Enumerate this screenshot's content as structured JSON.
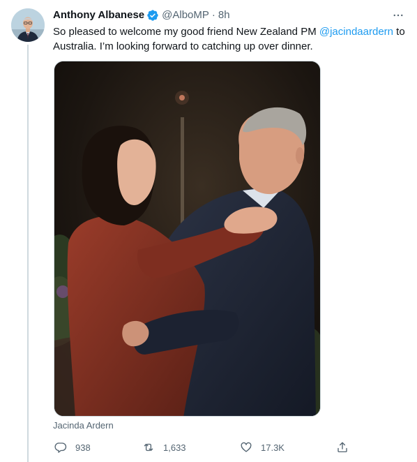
{
  "tweet": {
    "author_name": "Anthony Albanese",
    "handle": "@AlboMP",
    "separator": "·",
    "time": "8h",
    "text_before": "So pleased to welcome my good friend New Zealand PM ",
    "mention": "@jacindaardern",
    "text_after": " to Australia. I’m looking forward to catching up over dinner.",
    "media_tag": "Jacinda Ardern"
  },
  "actions": {
    "replies": "938",
    "retweets": "1,633",
    "likes": "17.3K"
  },
  "icons": {
    "verified": "verified-badge-icon",
    "more": "more-options-icon",
    "reply": "reply-icon",
    "retweet": "retweet-icon",
    "like": "heart-icon",
    "share": "share-icon"
  },
  "colors": {
    "accent": "#1d9bf0",
    "secondary_text": "#536471",
    "primary_text": "#0f1419",
    "thread_line": "#cfd9de"
  }
}
